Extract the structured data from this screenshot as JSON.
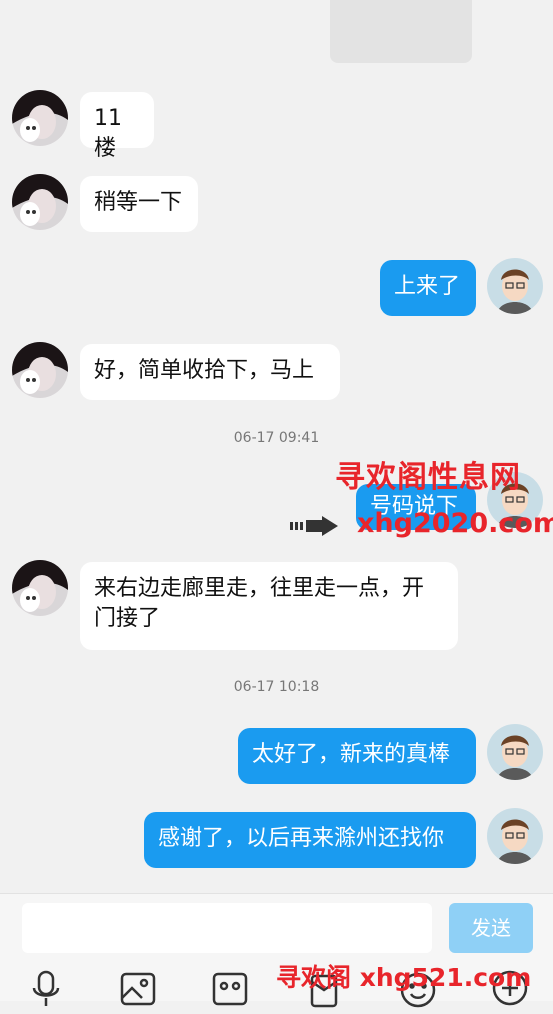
{
  "colors": {
    "accent": "#1a9bf0",
    "background": "#f1f1f1",
    "watermark": "#e8252b"
  },
  "messages": [
    {
      "side": "left",
      "text": "11楼"
    },
    {
      "side": "left",
      "text": "稍等一下"
    },
    {
      "side": "right",
      "text": "上来了"
    },
    {
      "side": "left",
      "text": "好，简单收拾下，马上"
    },
    {
      "side": "right",
      "text": "号码说下"
    },
    {
      "side": "left",
      "text": "来右边走廊里走，往里走一点，开门接了"
    },
    {
      "side": "right",
      "text": "太好了，新来的真棒"
    },
    {
      "side": "right",
      "text": "感谢了，以后再来滁州还找你"
    }
  ],
  "timestamps": [
    "06-17 09:41",
    "06-17 10:18"
  ],
  "watermarks": {
    "top_line1": "寻欢阁性息网",
    "top_line2": "xhg2020.com",
    "bottom": "寻欢阁 xhg521.com"
  },
  "input": {
    "value": "",
    "send_label": "发送"
  },
  "toolbar": [
    "microphone-icon",
    "image-icon",
    "camera-icon",
    "red-packet-icon",
    "emoji-icon",
    "plus-icon"
  ]
}
